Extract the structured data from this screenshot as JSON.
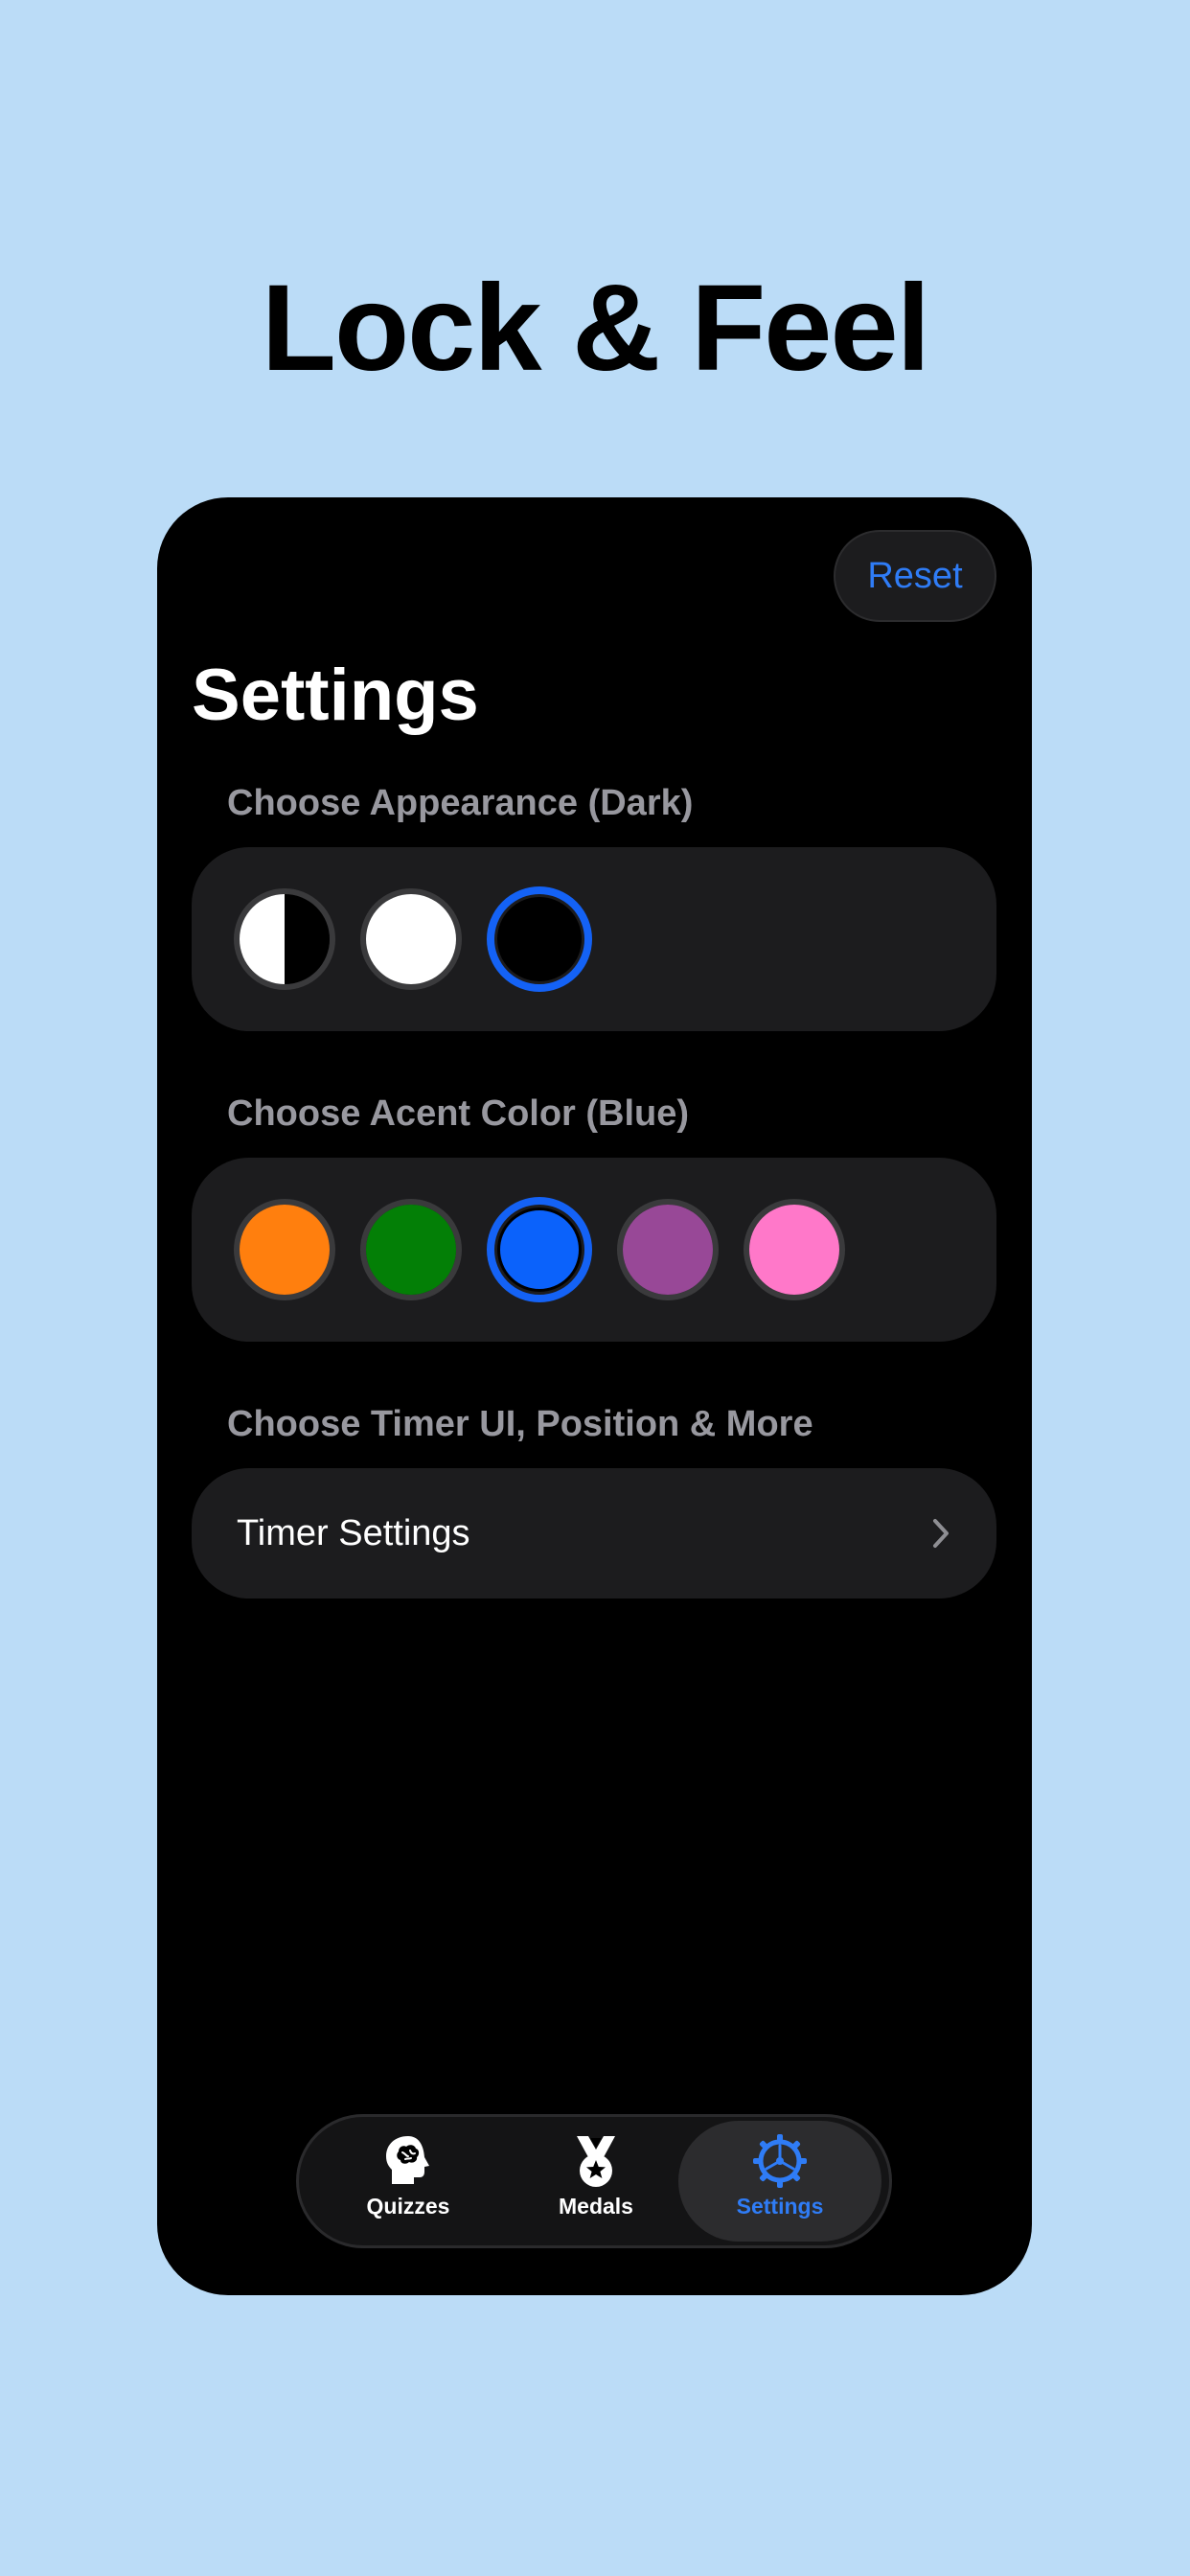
{
  "headline": "Lock & Feel",
  "header": {
    "reset_label": "Reset"
  },
  "page": {
    "title": "Settings"
  },
  "appearance": {
    "label": "Choose Appearance (Dark)",
    "options": [
      {
        "name": "system",
        "selected": false
      },
      {
        "name": "light",
        "color": "#ffffff",
        "selected": false
      },
      {
        "name": "dark",
        "color": "#000000",
        "selected": true
      }
    ]
  },
  "accent": {
    "label": "Choose Acent Color (Blue)",
    "options": [
      {
        "name": "orange",
        "color": "#ff7f0e",
        "selected": false
      },
      {
        "name": "green",
        "color": "#037f06",
        "selected": false
      },
      {
        "name": "blue",
        "color": "#0b62fb",
        "selected": true
      },
      {
        "name": "purple",
        "color": "#984897",
        "selected": false
      },
      {
        "name": "pink",
        "color": "#ff78c9",
        "selected": false
      }
    ]
  },
  "timer": {
    "label": "Choose Timer UI, Position & More",
    "row_label": "Timer Settings",
    "chevron_icon": "chevron-right-icon"
  },
  "tabs": [
    {
      "label": "Quizzes",
      "icon": "brain-head-icon",
      "active": false
    },
    {
      "label": "Medals",
      "icon": "medal-icon",
      "active": false
    },
    {
      "label": "Settings",
      "icon": "gear-icon",
      "active": true
    }
  ],
  "colors": {
    "background": "#bbdcf7",
    "accent": "#2f7cf6",
    "card": "#1c1c1e",
    "section_label": "#98989f"
  }
}
